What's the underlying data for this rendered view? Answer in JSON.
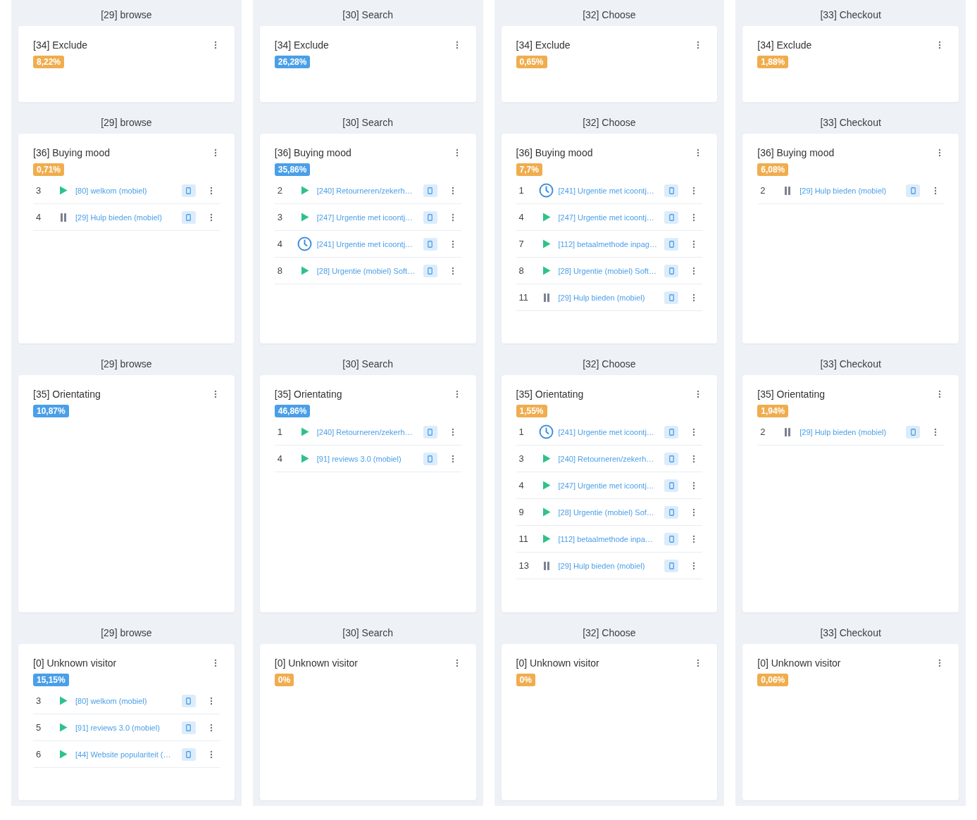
{
  "rows": [
    {
      "cells": [
        {
          "stage": "[29] browse",
          "segment": "[34] Exclude",
          "percent": "8,22%",
          "color": "#f0ad4e"
        },
        {
          "stage": "[30] Search",
          "segment": "[34] Exclude",
          "percent": "26,28%",
          "color": "#4a9fe8"
        },
        {
          "stage": "[32] Choose",
          "segment": "[34] Exclude",
          "percent": "0,65%",
          "color": "#f0ad4e"
        },
        {
          "stage": "[33] Checkout",
          "segment": "[34] Exclude",
          "percent": "1,88%",
          "color": "#f0ad4e"
        }
      ]
    },
    {
      "cells": [
        {
          "stage": "[29] browse",
          "segment": "[36] Buying mood",
          "percent": "0,71%",
          "color": "#f0ad4e",
          "items": [
            {
              "num": "3",
              "kind": "play",
              "label": "[80] welkom (mobiel)"
            },
            {
              "num": "4",
              "kind": "pause",
              "label": "[29] Hulp bieden (mobiel)"
            }
          ]
        },
        {
          "stage": "[30] Search",
          "segment": "[36] Buying mood",
          "percent": "35,86%",
          "color": "#4a9fe8",
          "items": [
            {
              "num": "2",
              "kind": "play",
              "label": "[240] Retourneren/zekerh…"
            },
            {
              "num": "3",
              "kind": "play",
              "label": "[247] Urgentie met icoontj…"
            },
            {
              "num": "4",
              "kind": "clock",
              "label": "[241] Urgentie met icoontj…"
            },
            {
              "num": "8",
              "kind": "play",
              "label": "[28] Urgentie (mobiel) Soft…"
            }
          ]
        },
        {
          "stage": "[32] Choose",
          "segment": "[36] Buying mood",
          "percent": "7,7%",
          "color": "#f0ad4e",
          "items": [
            {
              "num": "1",
              "kind": "clock",
              "label": "[241] Urgentie met icoontj…"
            },
            {
              "num": "4",
              "kind": "play",
              "label": "[247] Urgentie met icoontj…"
            },
            {
              "num": "7",
              "kind": "play",
              "label": "[112] betaalmethode inpag…"
            },
            {
              "num": "8",
              "kind": "play",
              "label": "[28] Urgentie (mobiel) Soft…"
            },
            {
              "num": "11",
              "kind": "pause",
              "label": "[29] Hulp bieden (mobiel)"
            }
          ]
        },
        {
          "stage": "[33] Checkout",
          "segment": "[36] Buying mood",
          "percent": "6,08%",
          "color": "#f0ad4e",
          "items": [
            {
              "num": "2",
              "kind": "pause",
              "label": "[29] Hulp bieden (mobiel)"
            }
          ]
        }
      ]
    },
    {
      "cells": [
        {
          "stage": "[29] browse",
          "segment": "[35] Orientating",
          "percent": "10,87%",
          "color": "#4a9fe8"
        },
        {
          "stage": "[30] Search",
          "segment": "[35] Orientating",
          "percent": "46,86%",
          "color": "#4a9fe8",
          "items": [
            {
              "num": "1",
              "kind": "play",
              "label": "[240] Retourneren/zekerh…"
            },
            {
              "num": "4",
              "kind": "play",
              "label": "[91] reviews 3.0 (mobiel)"
            }
          ]
        },
        {
          "stage": "[32] Choose",
          "segment": "[35] Orientating",
          "percent": "1,55%",
          "color": "#f0ad4e",
          "items": [
            {
              "num": "1",
              "kind": "clock",
              "label": "[241] Urgentie met icoontj…"
            },
            {
              "num": "3",
              "kind": "play",
              "label": "[240] Retourneren/zekerh…"
            },
            {
              "num": "4",
              "kind": "play",
              "label": "[247] Urgentie met icoontj…"
            },
            {
              "num": "9",
              "kind": "play",
              "label": "[28] Urgentie (mobiel) Sof…"
            },
            {
              "num": "11",
              "kind": "play",
              "label": "[112] betaalmethode inpa…"
            },
            {
              "num": "13",
              "kind": "pause",
              "label": "[29] Hulp bieden (mobiel)"
            }
          ]
        },
        {
          "stage": "[33] Checkout",
          "segment": "[35] Orientating",
          "percent": "1,94%",
          "color": "#f0ad4e",
          "items": [
            {
              "num": "2",
              "kind": "pause",
              "label": "[29] Hulp bieden (mobiel)"
            }
          ]
        }
      ]
    },
    {
      "cells": [
        {
          "stage": "[29] browse",
          "segment": "[0] Unknown visitor",
          "percent": "15,15%",
          "color": "#4a9fe8",
          "items": [
            {
              "num": "3",
              "kind": "play",
              "label": "[80] welkom (mobiel)"
            },
            {
              "num": "5",
              "kind": "play",
              "label": "[91] reviews 3.0 (mobiel)"
            },
            {
              "num": "6",
              "kind": "play",
              "label": "[44] Website populariteit (…"
            }
          ]
        },
        {
          "stage": "[30] Search",
          "segment": "[0] Unknown visitor",
          "percent": "0%",
          "color": "#f0ad4e"
        },
        {
          "stage": "[32] Choose",
          "segment": "[0] Unknown visitor",
          "percent": "0%",
          "color": "#f0ad4e"
        },
        {
          "stage": "[33] Checkout",
          "segment": "[0] Unknown visitor",
          "percent": "0,06%",
          "color": "#f0ad4e"
        }
      ]
    }
  ]
}
